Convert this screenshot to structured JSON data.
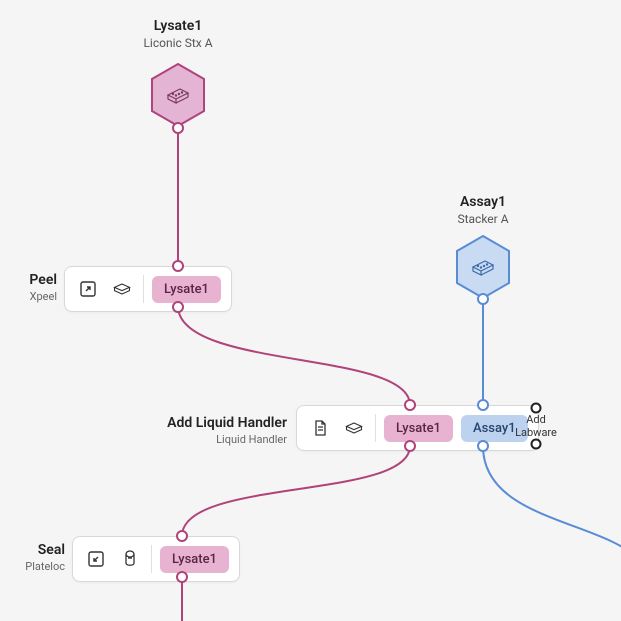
{
  "labware": {
    "lysate1": {
      "title": "Lysate1",
      "subtitle": "Liconic Stx A"
    },
    "assay1": {
      "title": "Assay1",
      "subtitle": "Stacker A"
    }
  },
  "steps": {
    "peel": {
      "title": "Peel",
      "subtitle": "Xpeel",
      "chips": [
        {
          "label": "Lysate1",
          "color": "pink"
        }
      ]
    },
    "addLiquidHandler": {
      "title": "Add Liquid Handler",
      "subtitle": "Liquid Handler",
      "chips": [
        {
          "label": "Lysate1",
          "color": "pink"
        },
        {
          "label": "Assay1",
          "color": "blue"
        }
      ],
      "addLabware": "Add\nLabware"
    },
    "seal": {
      "title": "Seal",
      "subtitle": "Plateloc",
      "chips": [
        {
          "label": "Lysate1",
          "color": "pink"
        }
      ]
    }
  },
  "colors": {
    "pink": "#b0437a",
    "blue": "#5a8cd6"
  }
}
